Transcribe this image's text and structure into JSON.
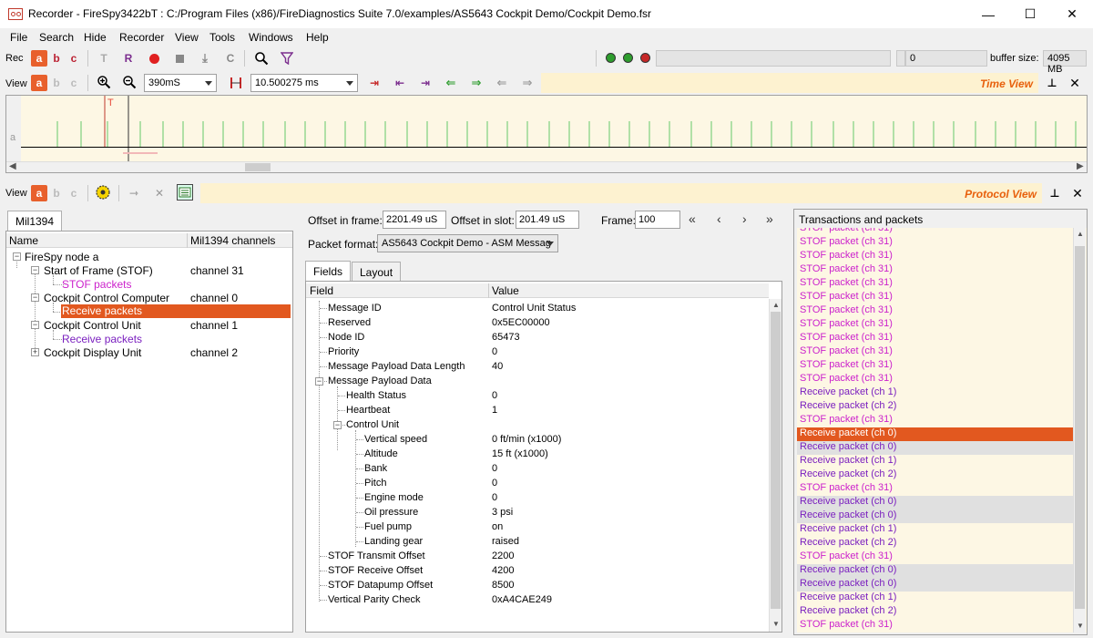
{
  "window": {
    "title": "Recorder - FireSpy3422bT : C:/Program Files (x86)/FireDiagnostics Suite 7.0/examples/AS5643 Cockpit Demo/Cockpit Demo.fsr",
    "min_glyph": "—",
    "max_glyph": "☐",
    "close_glyph": "✕"
  },
  "menu": [
    "File",
    "Search",
    "Hide",
    "Recorder",
    "View",
    "Tools",
    "Windows",
    "Help"
  ],
  "rec_toolbar": {
    "label": "Rec",
    "abc": [
      "a",
      "b",
      "c"
    ],
    "t_glyph": "T",
    "r_glyph": "R",
    "c_glyph": "C",
    "counter_value": "0",
    "buffer_label": "buffer size:",
    "buffer_value": "4095 MB"
  },
  "view_toolbar": {
    "label": "View",
    "abc": [
      "a",
      "b",
      "c"
    ],
    "zoom_value": "390mS",
    "time_value": "10.500275 ms",
    "panel_title": "Time View",
    "pin_glyph": "📌",
    "close_glyph": "✕"
  },
  "time_view": {
    "row_label": "a",
    "marker_label": "T"
  },
  "protocol_toolbar": {
    "label": "View",
    "abc": [
      "a",
      "b",
      "c"
    ],
    "panel_title": "Protocol View",
    "close_glyph": "✕"
  },
  "left_panel": {
    "tab": "Mil1394",
    "col_name": "Name",
    "col_channels": "Mil1394 channels",
    "tree": [
      {
        "label": "FireSpy node a",
        "channel": ""
      },
      {
        "label": "Start of Frame (STOF)",
        "channel": "channel 31"
      },
      {
        "label": "STOF packets",
        "channel": ""
      },
      {
        "label": "Cockpit Control Computer",
        "channel": "channel 0"
      },
      {
        "label": "Receive packets",
        "channel": ""
      },
      {
        "label": "Cockpit Control Unit",
        "channel": "channel 1"
      },
      {
        "label": "Receive packets",
        "channel": ""
      },
      {
        "label": "Cockpit Display Unit",
        "channel": "channel 2"
      }
    ]
  },
  "middle_panel": {
    "offset_frame_label": "Offset in frame:",
    "offset_frame_value": "2201.49 uS",
    "offset_slot_label": "Offset in slot:",
    "offset_slot_value": "201.49 uS",
    "frame_label": "Frame:",
    "frame_value": "100",
    "nav": [
      "«",
      "‹",
      "›",
      "»"
    ],
    "packet_format_label": "Packet format:",
    "packet_format_value": "AS5643 Cockpit Demo - ASM Messag",
    "tabs": [
      "Fields",
      "Layout"
    ],
    "col_field": "Field",
    "col_value": "Value",
    "fields": [
      {
        "field": "Message ID",
        "value": "Control Unit Status"
      },
      {
        "field": "Reserved",
        "value": "0x5EC00000"
      },
      {
        "field": "Node ID",
        "value": "65473"
      },
      {
        "field": "Priority",
        "value": "0"
      },
      {
        "field": "Message Payload Data Length",
        "value": "40"
      },
      {
        "field": "Message Payload Data",
        "value": ""
      },
      {
        "field": "Health Status",
        "value": "0"
      },
      {
        "field": "Heartbeat",
        "value": "1"
      },
      {
        "field": "Control Unit",
        "value": ""
      },
      {
        "field": "Vertical speed",
        "value": "0 ft/min (x1000)"
      },
      {
        "field": "Altitude",
        "value": "15 ft (x1000)"
      },
      {
        "field": "Bank",
        "value": "0"
      },
      {
        "field": "Pitch",
        "value": "0"
      },
      {
        "field": "Engine mode",
        "value": "0"
      },
      {
        "field": "Oil pressure",
        "value": "3 psi"
      },
      {
        "field": "Fuel pump",
        "value": "on"
      },
      {
        "field": "Landing gear",
        "value": "raised"
      },
      {
        "field": "STOF Transmit Offset",
        "value": "2200"
      },
      {
        "field": "STOF Receive Offset",
        "value": "4200"
      },
      {
        "field": "STOF Datapump Offset",
        "value": "8500"
      },
      {
        "field": "Vertical Parity Check",
        "value": "0xA4CAE249"
      }
    ]
  },
  "right_panel": {
    "title": "Transactions and packets",
    "transactions": [
      "STOF packet (ch 31)",
      "STOF packet (ch 31)",
      "STOF packet (ch 31)",
      "STOF packet (ch 31)",
      "STOF packet (ch 31)",
      "STOF packet (ch 31)",
      "STOF packet (ch 31)",
      "STOF packet (ch 31)",
      "STOF packet (ch 31)",
      "STOF packet (ch 31)",
      "STOF packet (ch 31)",
      "STOF packet (ch 31)",
      "Receive packet (ch 1)",
      "Receive packet (ch 2)",
      "STOF packet (ch 31)",
      "Receive packet (ch 0)",
      "Receive packet (ch 0)",
      "Receive packet (ch 1)",
      "Receive packet (ch 2)",
      "STOF packet (ch 31)",
      "Receive packet (ch 0)",
      "Receive packet (ch 0)",
      "Receive packet (ch 1)",
      "Receive packet (ch 2)",
      "STOF packet (ch 31)",
      "Receive packet (ch 0)",
      "Receive packet (ch 0)",
      "Receive packet (ch 1)",
      "Receive packet (ch 2)",
      "STOF packet (ch 31)"
    ]
  },
  "colors": {
    "accent_orange": "#e2581f",
    "stof_magenta": "#cc22cc",
    "receive_purple": "#7a1fbf",
    "highlight_gray": "#e0e0e0",
    "panel_title_orange": "#e8600c"
  }
}
